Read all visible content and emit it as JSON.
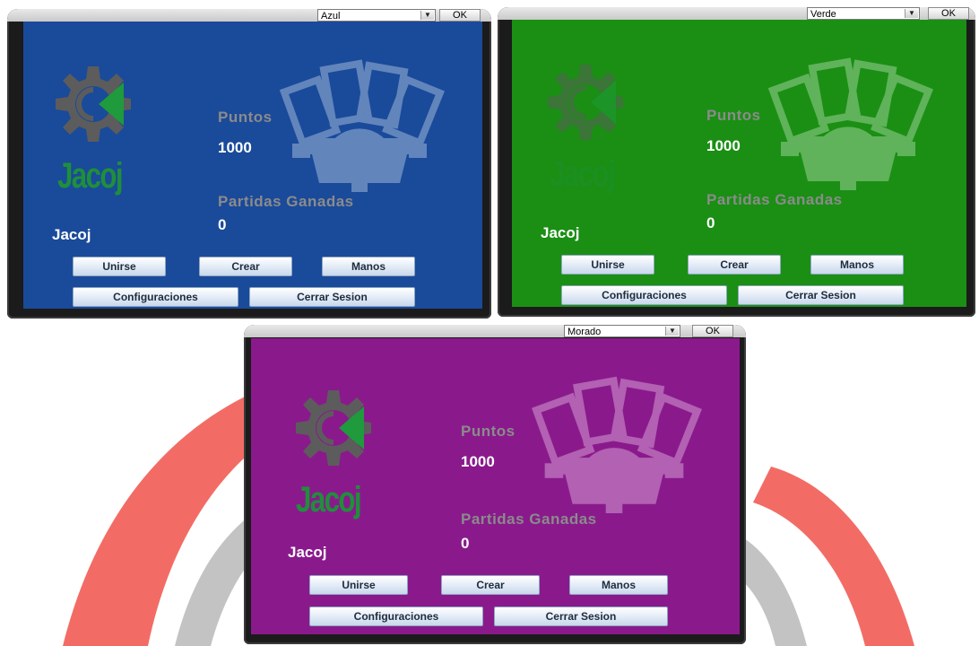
{
  "windows": [
    {
      "theme": "Azul",
      "panel_color": "#1a4a9a",
      "art_color": "#b9cde6",
      "combo_value": "Azul",
      "ok_label": "OK",
      "labels": {
        "puntos": "Puntos",
        "puntos_value": "1000",
        "partidas": "Partidas Ganadas",
        "partidas_value": "0",
        "username": "Jacoj"
      },
      "buttons": {
        "unirse": "Unirse",
        "crear": "Crear",
        "manos": "Manos",
        "configuraciones": "Configuraciones",
        "cerrar_sesion": "Cerrar Sesion"
      }
    },
    {
      "theme": "Verde",
      "panel_color": "#1a8f14",
      "art_color": "#b5e0b0",
      "combo_value": "Verde",
      "ok_label": "OK",
      "labels": {
        "puntos": "Puntos",
        "puntos_value": "1000",
        "partidas": "Partidas Ganadas",
        "partidas_value": "0",
        "username": "Jacoj"
      },
      "buttons": {
        "unirse": "Unirse",
        "crear": "Crear",
        "manos": "Manos",
        "configuraciones": "Configuraciones",
        "cerrar_sesion": "Cerrar Sesion"
      }
    },
    {
      "theme": "Morado",
      "panel_color": "#8a1a8c",
      "art_color": "#e3b8e4",
      "combo_value": "Morado",
      "ok_label": "OK",
      "labels": {
        "puntos": "Puntos",
        "puntos_value": "1000",
        "partidas": "Partidas Ganadas",
        "partidas_value": "0",
        "username": "Jacoj"
      },
      "buttons": {
        "unirse": "Unirse",
        "crear": "Crear",
        "manos": "Manos",
        "configuraciones": "Configuraciones",
        "cerrar_sesion": "Cerrar Sesion"
      }
    }
  ],
  "logo": {
    "word": "Jacoj",
    "gear_color": "#5c5c5c",
    "arrow_color": "#1f9a3c"
  },
  "background_art": {
    "accent_red": "#f0524a",
    "accent_grey": "#b8b8b8"
  }
}
